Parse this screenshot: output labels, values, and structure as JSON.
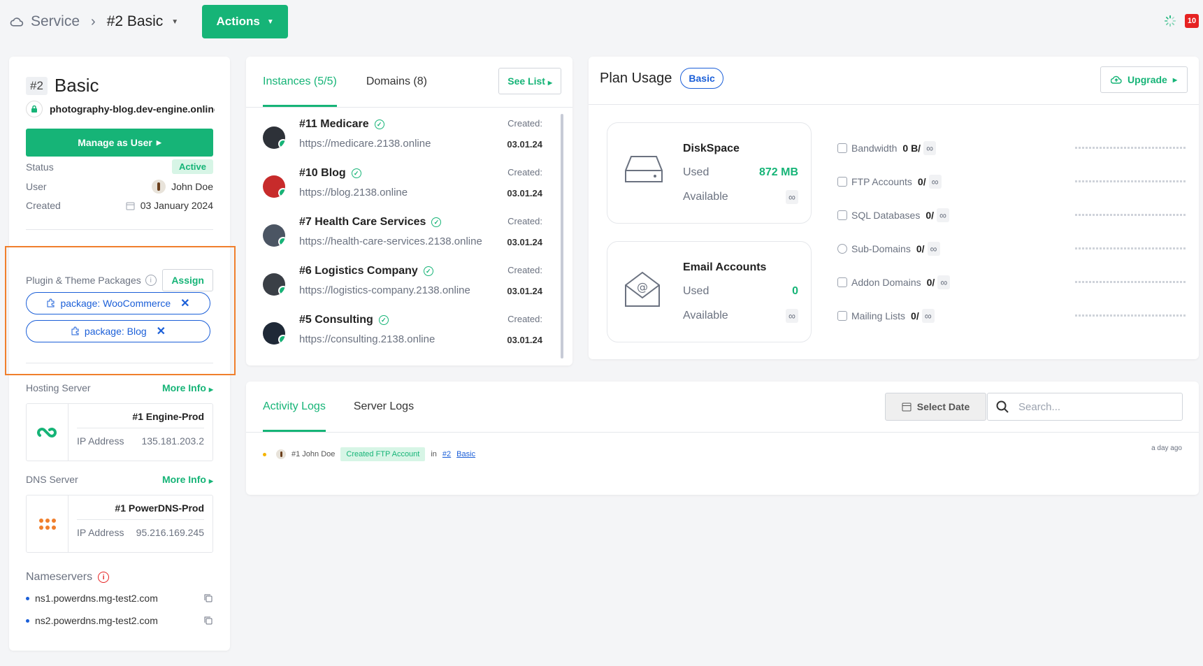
{
  "breadcrumb": {
    "service": "Service",
    "current": "#2 Basic"
  },
  "actions_label": "Actions",
  "notifications": "10",
  "service": {
    "number": "#2",
    "name": "Basic",
    "domain": "photography-blog.dev-engine.online",
    "manage_label": "Manage as User",
    "status_label": "Status",
    "status_value": "Active",
    "user_label": "User",
    "user_value": "John Doe",
    "created_label": "Created",
    "created_value": "03 January 2024"
  },
  "packages": {
    "label": "Plugin & Theme Packages",
    "assign_label": "Assign",
    "items": [
      "package: WooCommerce",
      "package: Blog"
    ]
  },
  "hosting": {
    "label": "Hosting Server",
    "more": "More Info",
    "name": "#1 Engine-Prod",
    "ip_label": "IP Address",
    "ip": "135.181.203.2"
  },
  "dns": {
    "label": "DNS Server",
    "more": "More Info",
    "name": "#1 PowerDNS-Prod",
    "ip_label": "IP Address",
    "ip": "95.216.169.245"
  },
  "nameservers": {
    "label": "Nameservers",
    "items": [
      "ns1.powerdns.mg-test2.com",
      "ns2.powerdns.mg-test2.com"
    ]
  },
  "instances": {
    "tab_instances": "Instances (5/5)",
    "tab_domains": "Domains (8)",
    "see_list": "See List",
    "created_label": "Created:",
    "items": [
      {
        "title": "#11 Medicare",
        "url": "https://medicare.2138.online",
        "date": "03.01.24"
      },
      {
        "title": "#10 Blog",
        "url": "https://blog.2138.online",
        "date": "03.01.24"
      },
      {
        "title": "#7 Health Care Services",
        "url": "https://health-care-services.2138.online",
        "date": "03.01.24"
      },
      {
        "title": "#6 Logistics Company",
        "url": "https://logistics-company.2138.online",
        "date": "03.01.24"
      },
      {
        "title": "#5 Consulting",
        "url": "https://consulting.2138.online",
        "date": "03.01.24"
      }
    ]
  },
  "plan": {
    "title": "Plan Usage",
    "badge": "Basic",
    "upgrade": "Upgrade",
    "disk": {
      "name": "DiskSpace",
      "used_label": "Used",
      "used": "872 MB",
      "avail_label": "Available"
    },
    "email": {
      "name": "Email Accounts",
      "used_label": "Used",
      "used": "0",
      "avail_label": "Available"
    },
    "metrics": [
      {
        "label": "Bandwidth",
        "value": "0 B/"
      },
      {
        "label": "FTP Accounts",
        "value": "0/"
      },
      {
        "label": "SQL Databases",
        "value": "0/"
      },
      {
        "label": "Sub-Domains",
        "value": "0/"
      },
      {
        "label": "Addon Domains",
        "value": "0/"
      },
      {
        "label": "Mailing Lists",
        "value": "0/"
      }
    ]
  },
  "logs": {
    "tab_activity": "Activity Logs",
    "tab_server": "Server Logs",
    "select_date": "Select Date",
    "search_placeholder": "Search...",
    "entry": {
      "user": "#1 John Doe",
      "action": "Created FTP Account",
      "in": "in",
      "ref_num": "#2",
      "ref_name": "Basic",
      "time": "a day ago"
    }
  }
}
